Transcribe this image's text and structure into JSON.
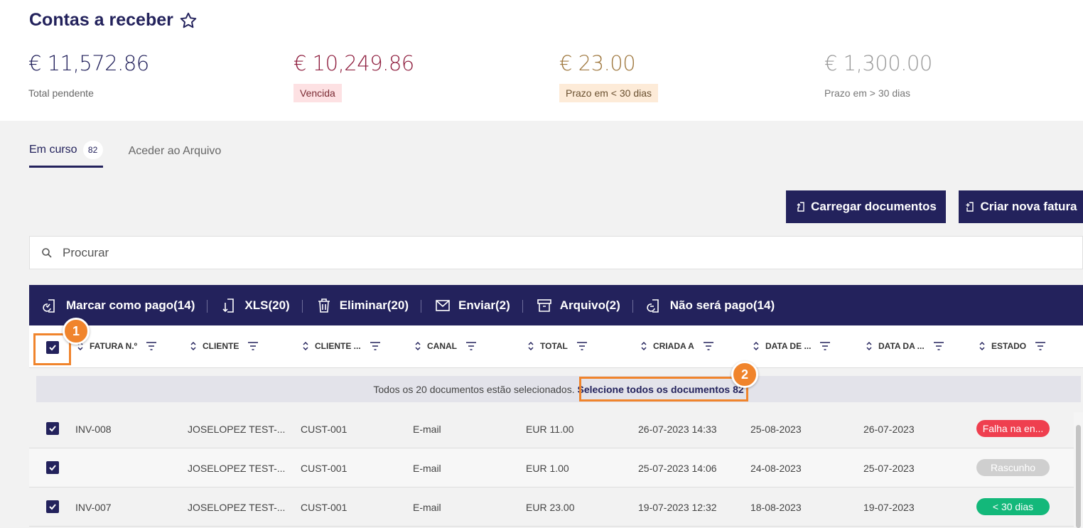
{
  "page": {
    "title": "Contas a receber"
  },
  "kpis": [
    {
      "amount": "€ 11,572.86",
      "label": "Total pendente"
    },
    {
      "amount": "€ 10,249.86",
      "label": "Vencida"
    },
    {
      "amount": "€ 23.00",
      "label": "Prazo em < 30 dias"
    },
    {
      "amount": "€ 1,300.00",
      "label": "Prazo em > 30 dias"
    }
  ],
  "tabs": [
    {
      "label": "Em curso",
      "count": "82"
    },
    {
      "label": "Aceder ao Arquivo"
    }
  ],
  "buttons": {
    "upload": "Carregar documentos",
    "create": "Criar nova fatura"
  },
  "search": {
    "placeholder": "Procurar"
  },
  "actions": [
    {
      "label": "Marcar como pago(14)",
      "icon": "mark-paid-icon"
    },
    {
      "label": "XLS(20)",
      "icon": "download-icon"
    },
    {
      "label": "Eliminar(20)",
      "icon": "trash-icon"
    },
    {
      "label": "Enviar(2)",
      "icon": "mail-icon"
    },
    {
      "label": "Arquivo(2)",
      "icon": "archive-icon"
    },
    {
      "label": "Não será pago(14)",
      "icon": "not-paid-icon"
    }
  ],
  "columns": [
    "FATURA N.º",
    "CLIENTE",
    "CLIENTE ...",
    "CANAL",
    "TOTAL",
    "CRIADA A",
    "DATA DE ...",
    "DATA DA ...",
    "ESTADO"
  ],
  "selection": {
    "message": "Todos os 20 documentos estão selecionados.",
    "link": "Selecione todos os documentos 82"
  },
  "rows": [
    {
      "invoice": "INV-008",
      "client": "JOSELOPEZ TEST-...",
      "client_id": "CUST-001",
      "channel": "E-mail",
      "total": "EUR 11.00",
      "created": "26-07-2023 14:33",
      "date1": "25-08-2023",
      "date2": "26-07-2023",
      "status": "Falha na en...",
      "status_color": "#ef3f4f"
    },
    {
      "invoice": "",
      "client": "JOSELOPEZ TEST-...",
      "client_id": "CUST-001",
      "channel": "E-mail",
      "total": "EUR 1.00",
      "created": "25-07-2023 14:06",
      "date1": "24-08-2023",
      "date2": "25-07-2023",
      "status": "Rascunho",
      "status_color": "#cfcfcf"
    },
    {
      "invoice": "INV-007",
      "client": "JOSELOPEZ TEST-...",
      "client_id": "CUST-001",
      "channel": "E-mail",
      "total": "EUR 23.00",
      "created": "19-07-2023 12:32",
      "date1": "18-08-2023",
      "date2": "19-07-2023",
      "status": "< 30 dias",
      "status_color": "#13b87a"
    }
  ],
  "markers": [
    "1",
    "2"
  ],
  "colors": {
    "primary": "#23225c",
    "highlight": "#f0842c"
  }
}
